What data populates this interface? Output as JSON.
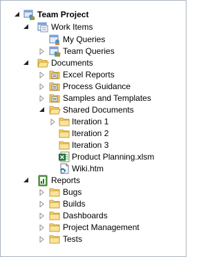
{
  "tree": {
    "root": {
      "label": "Team Project",
      "expanded": true,
      "icon": "team-project-icon"
    },
    "work_items": {
      "label": "Work Items",
      "expanded": true,
      "icon": "work-items-icon",
      "children": [
        {
          "label": "My Queries",
          "expandable": false,
          "icon": "queries-folder-icon"
        },
        {
          "label": "Team Queries",
          "expandable": true,
          "expanded": false,
          "icon": "queries-folder-icon"
        }
      ]
    },
    "documents": {
      "label": "Documents",
      "expanded": true,
      "icon": "folder-open-icon",
      "children": [
        {
          "label": "Excel Reports",
          "expandable": true,
          "expanded": false,
          "icon": "document-library-icon"
        },
        {
          "label": "Process Guidance",
          "expandable": true,
          "expanded": false,
          "icon": "document-library-icon"
        },
        {
          "label": "Samples and Templates",
          "expandable": true,
          "expanded": false,
          "icon": "document-library-icon"
        },
        {
          "label": "Shared Documents",
          "expandable": true,
          "expanded": true,
          "icon": "folder-open-icon",
          "children": [
            {
              "label": "Iteration 1",
              "expandable": true,
              "expanded": false,
              "icon": "folder-icon"
            },
            {
              "label": "Iteration 2",
              "expandable": false,
              "icon": "folder-icon"
            },
            {
              "label": "Iteration 3",
              "expandable": false,
              "icon": "folder-icon"
            },
            {
              "label": "Product Planning.xlsm",
              "expandable": false,
              "icon": "excel-file-icon"
            },
            {
              "label": "Wiki.htm",
              "expandable": false,
              "icon": "web-page-icon"
            }
          ]
        }
      ]
    },
    "reports": {
      "label": "Reports",
      "expanded": true,
      "icon": "reports-icon",
      "children": [
        {
          "label": "Bugs",
          "expandable": true,
          "expanded": false,
          "icon": "folder-icon"
        },
        {
          "label": "Builds",
          "expandable": true,
          "expanded": false,
          "icon": "folder-icon"
        },
        {
          "label": "Dashboards",
          "expandable": true,
          "expanded": false,
          "icon": "folder-icon"
        },
        {
          "label": "Project Management",
          "expandable": true,
          "expanded": false,
          "icon": "folder-icon"
        },
        {
          "label": "Tests",
          "expandable": true,
          "expanded": false,
          "icon": "folder-icon"
        }
      ]
    }
  },
  "colors": {
    "border": "#a9b3bd",
    "folder_fill": "#f6d77a",
    "folder_stroke": "#c89b2c",
    "twisty_collapsed": "#8e8e8e",
    "twisty_expanded": "#262626"
  }
}
